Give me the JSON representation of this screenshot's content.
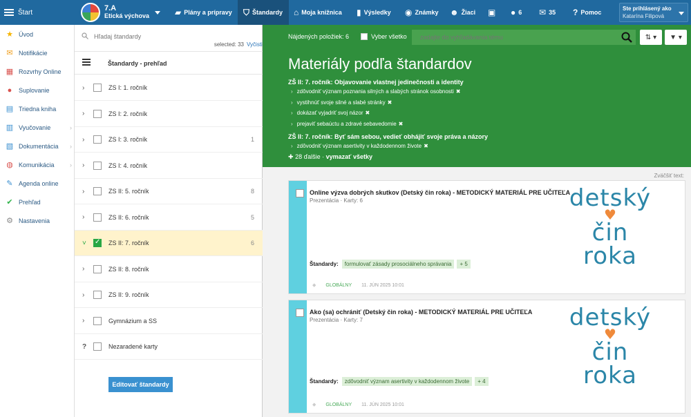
{
  "topbar": {
    "start_label": "Štart",
    "class_name": "7.A",
    "class_subject": "Etická výchova",
    "nav": [
      {
        "label": "Plány a prípravy",
        "icon": "briefcase-icon"
      },
      {
        "label": "Štandardy",
        "icon": "shield-icon"
      },
      {
        "label": "Moja knižnica",
        "icon": "library-icon"
      },
      {
        "label": "Výsledky",
        "icon": "bar-chart-icon"
      },
      {
        "label": "Známky",
        "icon": "grades-icon"
      },
      {
        "label": "Žiaci",
        "icon": "students-icon"
      },
      {
        "label": "",
        "icon": "screen-icon"
      },
      {
        "label": "6",
        "icon": "chat-icon"
      },
      {
        "label": "35",
        "icon": "mail-icon"
      },
      {
        "label": "Pomoc",
        "icon": "help-icon"
      }
    ],
    "user_line1": "Ste prihlásený ako",
    "user_line2": "Katarína Filipová"
  },
  "sidebar": {
    "items": [
      {
        "label": "Úvod",
        "icon": "star-icon",
        "color": "#f5b400"
      },
      {
        "label": "Notifikácie",
        "icon": "envelope-icon",
        "color": "#f0a020"
      },
      {
        "label": "Rozvrhy Online",
        "icon": "calendar-icon",
        "color": "#d9534f"
      },
      {
        "label": "Suplovanie",
        "icon": "user-icon",
        "color": "#d9534f"
      },
      {
        "label": "Triedna kniha",
        "icon": "book-icon",
        "color": "#3a8fd0"
      },
      {
        "label": "Vyučovanie",
        "icon": "open-book-icon",
        "color": "#3a8fd0",
        "arrow": true
      },
      {
        "label": "Dokumentácia",
        "icon": "document-icon",
        "color": "#3a8fd0",
        "arrow": true
      },
      {
        "label": "Komunikácia",
        "icon": "comments-icon",
        "color": "#d9534f",
        "arrow": true
      },
      {
        "label": "Agenda online",
        "icon": "pen-icon",
        "color": "#3a8fd0"
      },
      {
        "label": "Prehľad",
        "icon": "check-circle-icon",
        "color": "#2fb34a"
      },
      {
        "label": "Nastavenia",
        "icon": "cog-icon",
        "color": "#888888"
      }
    ]
  },
  "standards": {
    "search_placeholder": "Hľadaj štandardy",
    "selected_text": "selected: 33",
    "clear_label": "Vyčistiť",
    "overview_title": "Štandardy - prehľad",
    "rows": [
      {
        "label": "ZS I: 1. ročník",
        "count": ""
      },
      {
        "label": "ZS I: 2. ročník",
        "count": ""
      },
      {
        "label": "ZS I: 3. ročník",
        "count": "1"
      },
      {
        "label": "ZS I: 4. ročník",
        "count": ""
      },
      {
        "label": "ZS II: 5. ročník",
        "count": "8"
      },
      {
        "label": "ZS II: 6. ročník",
        "count": "5"
      },
      {
        "label": "ZS II: 7. ročník",
        "count": "6"
      },
      {
        "label": "ZS II: 8. ročník",
        "count": ""
      },
      {
        "label": "ZS II: 9. ročník",
        "count": ""
      },
      {
        "label": "Gymnázium a SS",
        "count": ""
      },
      {
        "label": "Nezaradené karty",
        "count": ""
      }
    ],
    "edit_button": "Editovať štandardy"
  },
  "main": {
    "found_label": "Nájdených položiek: 6",
    "select_all_label": "Vyber všetko",
    "search_placeholder": "zadajte do vyhľadávania tému",
    "title": "Materiály podľa štandardov",
    "section1_title": "ZŠ II: 7. ročník: Objavovanie vlastnej jedinečnosti a identity",
    "section1_items": [
      "zdôvodniť význam poznania silných a slabých stránok osobnosti",
      "vystihnúť svoje silné a slabé stránky",
      "dokázať vyjadriť svoj názor",
      "prejaviť sebaúctu a zdravé sebavedomie"
    ],
    "section2_title": "ZŠ II: 7. ročník: Byť sám sebou, vedieť obhájiť svoje práva a názory",
    "section2_items": [
      "zdôvodniť význam asertivity v každodennom živote"
    ],
    "more_label": "28 ďalšie",
    "clear_all_label": "vymazať všetky",
    "zoom_label": "Zväčšiť text:"
  },
  "cards": [
    {
      "title": "Online výzva dobrých skutkov (Detský čin roka) - METODICKÝ MATERIÁL PRE UČITEĽA",
      "subtitle": "Prezentácia · Karty: 6",
      "standards_label": "Štandardy:",
      "tag": "formulovať zásady prosociálneho správania",
      "more": "+ 5",
      "scope": "GLOBÁLNY",
      "date": "11. JÚN 2025 10:01",
      "logo_l1": "detský",
      "logo_l2": "čin",
      "logo_l3": "roka"
    },
    {
      "title": "Ako (sa) ochrániť (Detský čin roka) - METODICKÝ MATERIÁL PRE UČITEĽA",
      "subtitle": "Prezentácia · Karty: 7",
      "standards_label": "Štandardy:",
      "tag": "zdôvodniť význam asertivity v každodennom živote",
      "more": "+ 4",
      "scope": "GLOBÁLNY",
      "date": "11. JÚN 2025 10:01",
      "logo_l1": "detský",
      "logo_l2": "čin",
      "logo_l3": "roka"
    }
  ]
}
